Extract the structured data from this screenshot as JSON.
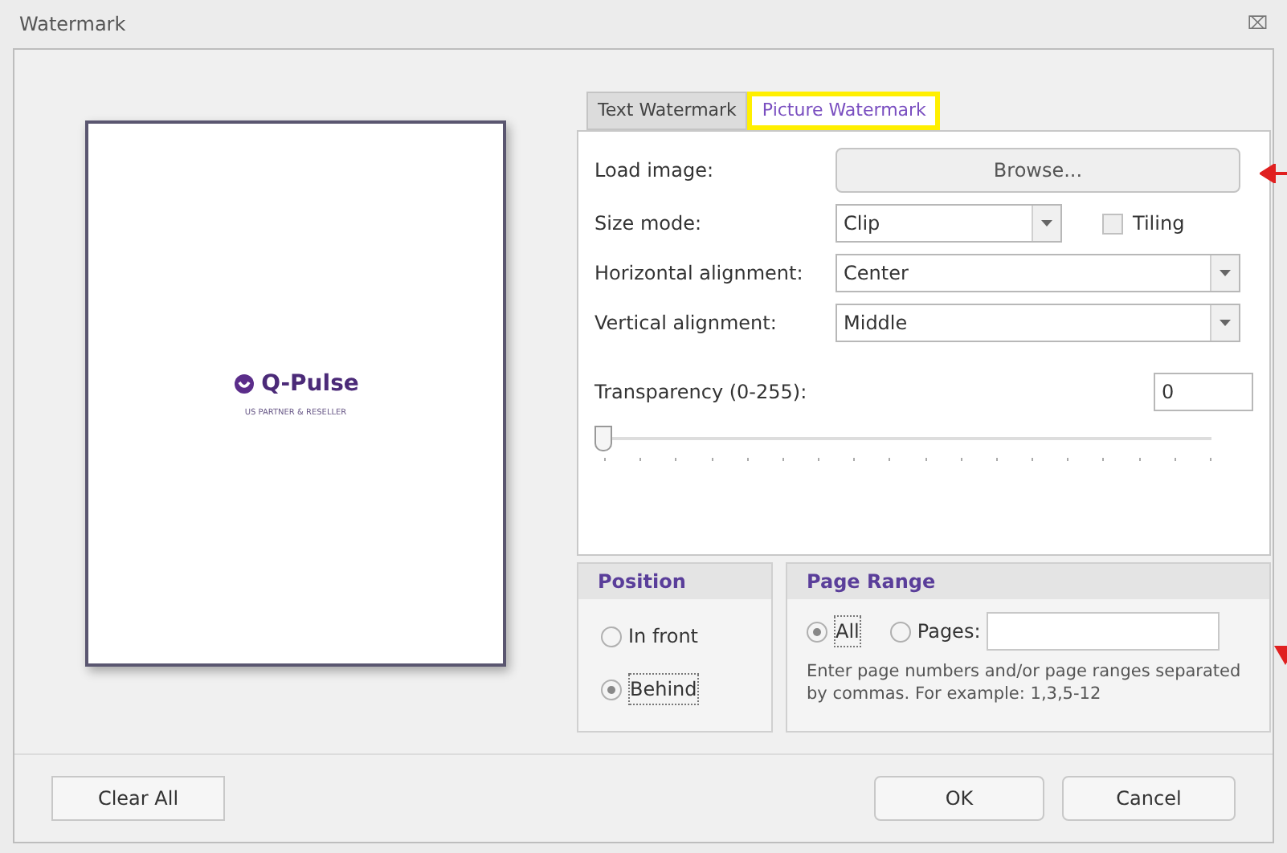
{
  "window": {
    "title": "Watermark",
    "close": "⌧"
  },
  "preview": {
    "logo_name": "Q-Pulse",
    "logo_tagline": "US PARTNER & RESELLER"
  },
  "tabs": [
    {
      "label": "Text Watermark",
      "selected": false,
      "highlighted": false
    },
    {
      "label": "Picture Watermark",
      "selected": true,
      "highlighted": true
    }
  ],
  "load_image": {
    "label": "Load image:",
    "button": "Browse...",
    "annotated": true
  },
  "size_mode": {
    "label": "Size mode:",
    "value": "Clip"
  },
  "tiling": {
    "label": "Tiling",
    "checked": false
  },
  "horizontal_alignment": {
    "label": "Horizontal alignment:",
    "value": "Center"
  },
  "vertical_alignment": {
    "label": "Vertical alignment:",
    "value": "Middle"
  },
  "transparency": {
    "label": "Transparency (0-255):",
    "value": "0",
    "level": 0
  },
  "position": {
    "title": "Position",
    "options": [
      {
        "label": "In front",
        "selected": false
      },
      {
        "label": "Behind",
        "selected": true
      }
    ]
  },
  "page_range": {
    "title": "Page Range",
    "options": [
      {
        "label": "All",
        "selected": true
      },
      {
        "label": "Pages:",
        "selected": false
      }
    ],
    "hint": "Enter page numbers and/or page ranges separated by commas. For example: 1,3,5-12",
    "annotated": true
  },
  "buttons": {
    "clear": "Clear All",
    "ok": "OK",
    "cancel": "Cancel"
  }
}
